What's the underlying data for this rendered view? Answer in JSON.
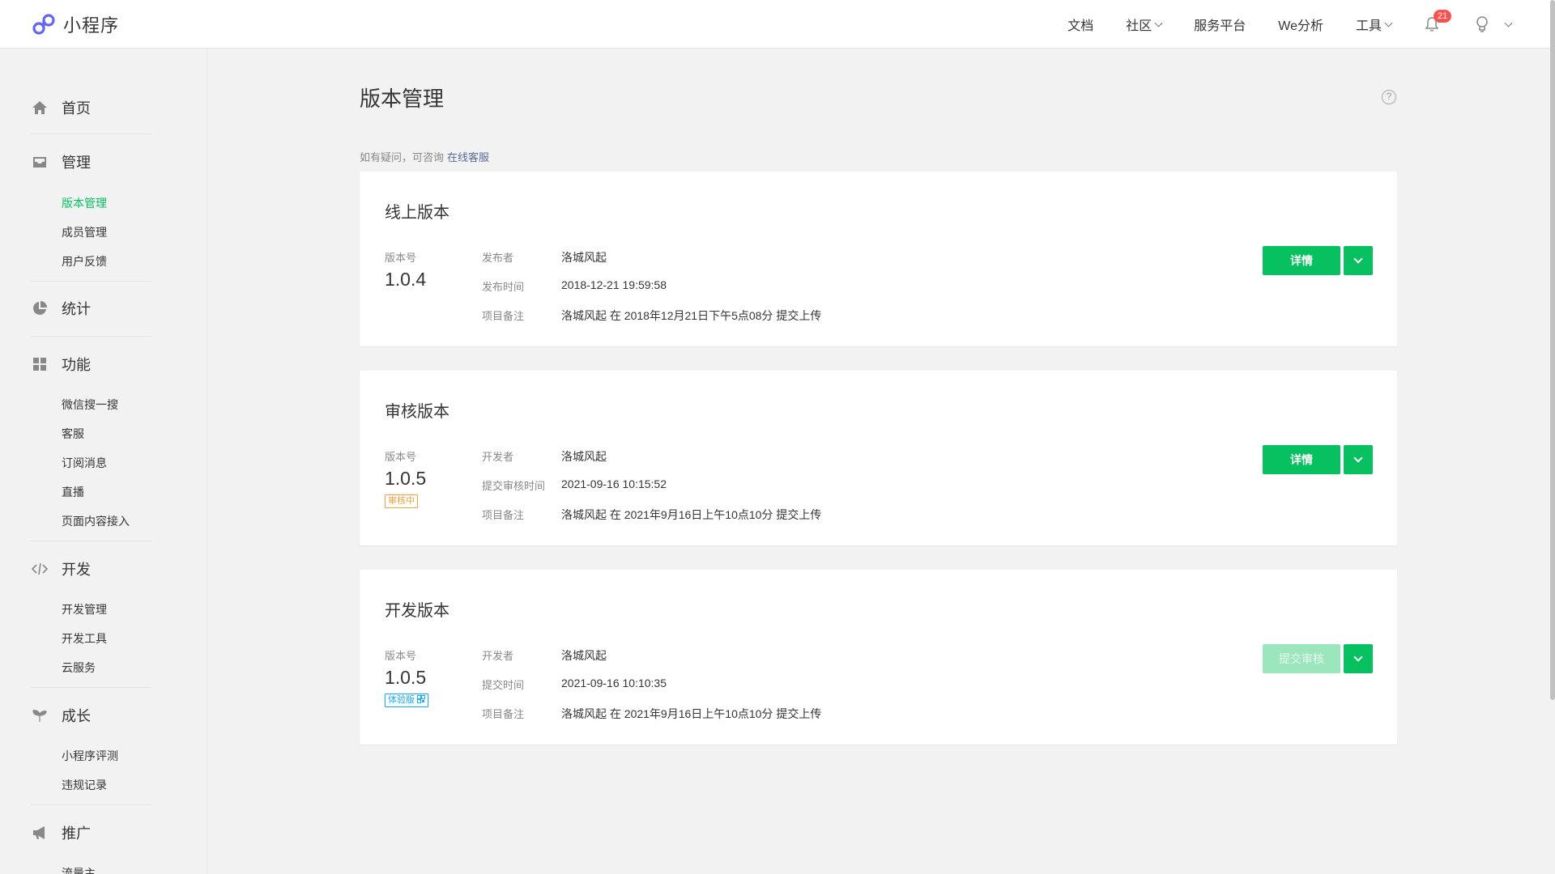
{
  "header": {
    "app_name": "小程序",
    "nav": [
      "文档",
      "社区",
      "服务平台",
      "We分析",
      "工具"
    ],
    "notification_count": "21"
  },
  "sidebar": {
    "home": "首页",
    "manage": {
      "title": "管理",
      "items": [
        "版本管理",
        "成员管理",
        "用户反馈"
      ]
    },
    "stats": "统计",
    "features": {
      "title": "功能",
      "items": [
        "微信搜一搜",
        "客服",
        "订阅消息",
        "直播",
        "页面内容接入"
      ]
    },
    "dev": {
      "title": "开发",
      "items": [
        "开发管理",
        "开发工具",
        "云服务"
      ]
    },
    "growth": {
      "title": "成长",
      "items": [
        "小程序评测",
        "违规记录"
      ]
    },
    "promo": {
      "title": "推广",
      "items": [
        "流量主"
      ]
    }
  },
  "main": {
    "title": "版本管理",
    "help": "?",
    "consult_text": "如有疑问，可咨询",
    "consult_link": "在线客服",
    "version_label": "版本号",
    "online": {
      "title": "线上版本",
      "version": "1.0.4",
      "rows": [
        {
          "key": "发布者",
          "value": "洛城风起"
        },
        {
          "key": "发布时间",
          "value": "2018-12-21 19:59:58"
        },
        {
          "key": "项目备注",
          "value": "洛城风起 在 2018年12月21日下午5点08分 提交上传"
        }
      ],
      "button": "详情"
    },
    "audit": {
      "title": "审核版本",
      "version": "1.0.5",
      "tag": "审核中",
      "rows": [
        {
          "key": "开发者",
          "value": "洛城风起"
        },
        {
          "key": "提交审核时间",
          "value": "2021-09-16 10:15:52"
        },
        {
          "key": "项目备注",
          "value": "洛城风起 在 2021年9月16日上午10点10分 提交上传"
        }
      ],
      "button": "详情"
    },
    "dev": {
      "title": "开发版本",
      "version": "1.0.5",
      "tag": "体验版",
      "rows": [
        {
          "key": "开发者",
          "value": "洛城风起"
        },
        {
          "key": "提交时间",
          "value": "2021-09-16 10:10:35"
        },
        {
          "key": "项目备注",
          "value": "洛城风起 在 2021年9月16日上午10点10分 提交上传"
        }
      ],
      "button": "提交审核"
    }
  },
  "colors": {
    "accent": "#07c160",
    "link": "#576b95",
    "badge": "#fa5151",
    "audit_tag": "#fa9d3b",
    "trial_tag": "#10aeff"
  }
}
